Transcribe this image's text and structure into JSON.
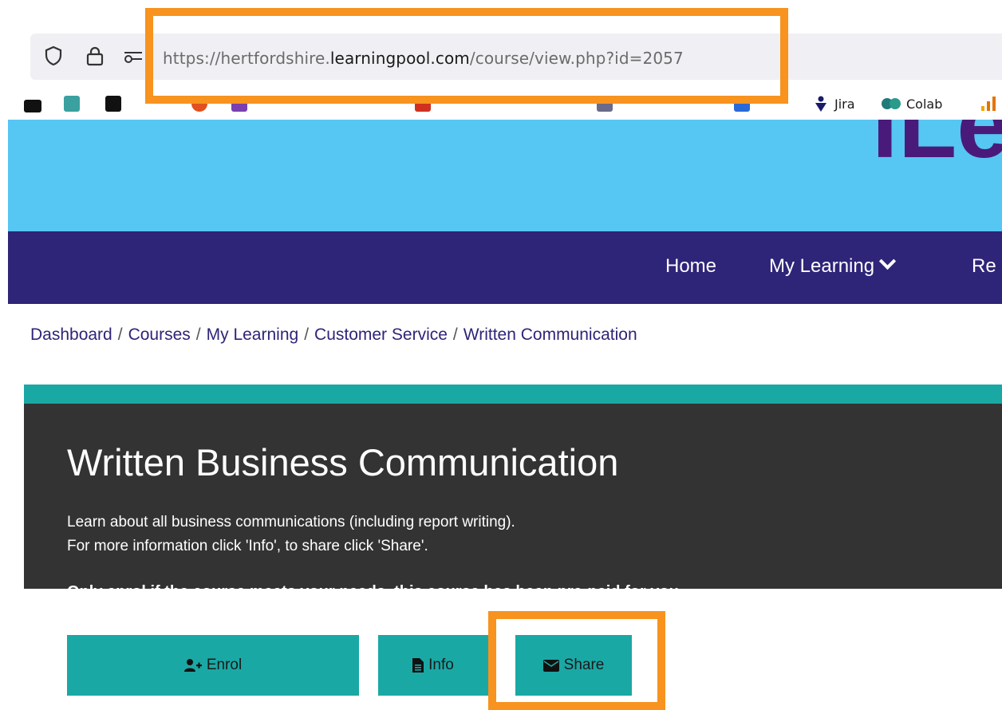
{
  "browser": {
    "url_prefix": "https://hertfordshire.",
    "url_host": "learningpool.com",
    "url_path": "/course/view.php?id=2057",
    "bookmarks": [
      {
        "label": "Jira",
        "icon": "jira-icon"
      },
      {
        "label": "Colab",
        "icon": "colab-icon"
      }
    ]
  },
  "site": {
    "logo_text": "iLe",
    "nav": {
      "home": "Home",
      "my_learning": "My Learning",
      "partial": "Re"
    }
  },
  "breadcrumb": [
    "Dashboard",
    "Courses",
    "My Learning",
    "Customer Service",
    "Written Communication"
  ],
  "course": {
    "title": "Written Business Communication",
    "desc_line1": "Learn about all business communications (including report writing).",
    "desc_line2": "For more information click 'Info', to share click 'Share'.",
    "note": "Only enrol if the course meets your needs, this course has been pre-paid for you.",
    "buttons": {
      "enrol": "Enrol",
      "info": "Info",
      "share": "Share"
    }
  },
  "colors": {
    "teal": "#1aa8a5",
    "navy": "#2e2478",
    "banner": "#56c6f3",
    "highlight": "#f7931e"
  }
}
